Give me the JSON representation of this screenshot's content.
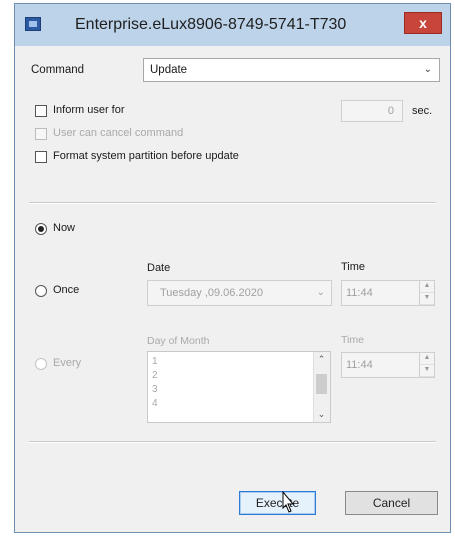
{
  "window": {
    "title": "Enterprise.eLux8906-8749-5741-T730",
    "close_glyph": "x"
  },
  "command": {
    "label": "Command",
    "value": "Update"
  },
  "options": {
    "inform_user_label": "Inform user for",
    "inform_user_value": "0",
    "inform_user_unit": "sec.",
    "user_can_cancel_label": "User can cancel command",
    "format_partition_label": "Format system partition before update"
  },
  "schedule": {
    "now_label": "Now",
    "now_selected": true,
    "once_label": "Once",
    "date_label": "Date",
    "date_value": "Tuesday  ,09.06.2020",
    "time_label": "Time",
    "time_value": "11:44",
    "every_label": "Every",
    "day_of_month_label": "Day of Month",
    "day_items": [
      "1",
      "2",
      "3",
      "4"
    ],
    "every_time_label": "Time",
    "every_time_value": "11:44"
  },
  "buttons": {
    "execute_label": "Execute",
    "cancel_label": "Cancel"
  },
  "colors": {
    "titlebar": "#bcd3ea",
    "close_button": "#c7453a",
    "default_button_border": "#2a7ad6"
  }
}
